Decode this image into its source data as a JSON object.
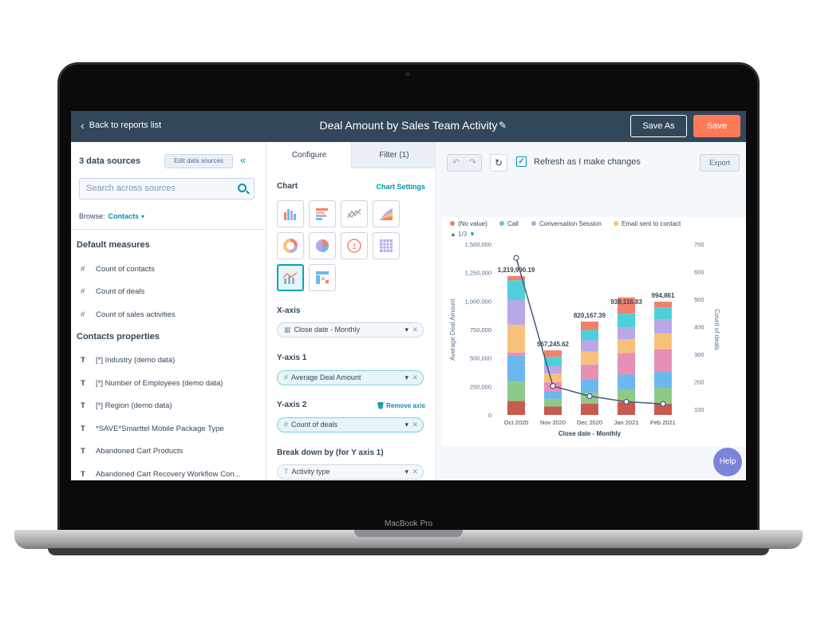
{
  "device": {
    "label": "MacBook Pro"
  },
  "header": {
    "back_label": "Back to reports list",
    "title": "Deal Amount by Sales Team Activity",
    "save_as_label": "Save As",
    "save_label": "Save"
  },
  "left_panel": {
    "data_sources_title": "3 data sources",
    "edit_sources_label": "Edit data sources",
    "search_placeholder": "Search across sources",
    "browse_label": "Browse:",
    "browse_value": "Contacts",
    "default_measures_title": "Default measures",
    "measures": [
      {
        "icon": "#",
        "label": "Count of contacts"
      },
      {
        "icon": "#",
        "label": "Count of deals"
      },
      {
        "icon": "#",
        "label": "Count of sales activities"
      }
    ],
    "properties_title": "Contacts properties",
    "properties": [
      {
        "icon": "T",
        "label": "[*] Industry (demo data)"
      },
      {
        "icon": "T",
        "label": "[*] Number of Employees (demo data)"
      },
      {
        "icon": "T",
        "label": "[*] Region (demo data)"
      },
      {
        "icon": "T",
        "label": "*SAVE*Smarttel Mobile Package Type"
      },
      {
        "icon": "T",
        "label": "Abandoned Cart Products"
      },
      {
        "icon": "T",
        "label": "Abandoned Cart Recovery Workflow Con..."
      }
    ]
  },
  "middle_panel": {
    "tabs": [
      "Configure",
      "Filter (1)"
    ],
    "chart_label": "Chart",
    "chart_settings_label": "Chart Settings",
    "chart_types": [
      "vertical-bar-chart-icon",
      "horizontal-bar-chart-icon",
      "line-chart-icon",
      "area-chart-icon",
      "donut-chart-icon",
      "pie-chart-icon",
      "single-value-icon",
      "table-chart-icon",
      "combination-chart-icon",
      "pivot-table-icon"
    ],
    "selected_chart_type": "combination-chart-icon",
    "x_axis_label": "X-axis",
    "x_axis_value": "Close date - Monthly",
    "y_axis1_label": "Y-axis 1",
    "y_axis1_value": "Average Deal Amount",
    "y_axis2_label": "Y-axis 2",
    "remove_axis_label": "Remove axis",
    "y_axis2_value": "Count of deals",
    "breakdown_label": "Break down by (for Y axis 1)",
    "breakdown_value": "Activity type"
  },
  "right_panel": {
    "refresh_label": "Refresh as I make changes",
    "refresh_checked": true,
    "export_label": "Export",
    "help_label": "Help"
  },
  "chart_data": {
    "type": "bar",
    "legend": [
      {
        "name": "(No value)",
        "color": "#f2816b"
      },
      {
        "name": "Call",
        "color": "#4fd0d9"
      },
      {
        "name": "Conversation Session",
        "color": "#b9a7e8"
      },
      {
        "name": "Email sent to contact",
        "color": "#f7c17c"
      }
    ],
    "legend_page": "1/3",
    "categories": [
      "Oct 2020",
      "Nov 2020",
      "Dec 2020",
      "Jan 2021",
      "Feb 2021"
    ],
    "totals": [
      1219990.19,
      567245.62,
      820167.39,
      938116.83,
      994861
    ],
    "total_labels": [
      "1,219,990.19",
      "567,245.62",
      "820,167.39",
      "938,116.83",
      "994,861"
    ],
    "stack_colors": [
      "#c85a4f",
      "#8fc98a",
      "#6bb7ee",
      "#e88fb6",
      "#f7c17c",
      "#b9a7e8",
      "#4fd0d9",
      "#f2816b"
    ],
    "stack_shares": [
      [
        0.1,
        0.14,
        0.19,
        0.02,
        0.2,
        0.18,
        0.14,
        0.03
      ],
      [
        0.13,
        0.12,
        0.12,
        0.14,
        0.13,
        0.12,
        0.14,
        0.1
      ],
      [
        0.12,
        0.12,
        0.14,
        0.16,
        0.14,
        0.12,
        0.11,
        0.09
      ],
      [
        0.12,
        0.12,
        0.14,
        0.2,
        0.13,
        0.11,
        0.13,
        0.15
      ],
      [
        0.1,
        0.14,
        0.14,
        0.2,
        0.14,
        0.12,
        0.11,
        0.05
      ]
    ],
    "line_series": {
      "name": "Count of deals",
      "values": [
        650,
        185,
        148,
        128,
        120
      ]
    },
    "y_left": {
      "label": "Average Deal Amount",
      "min": 0,
      "max": 1500000,
      "ticks": [
        "0",
        "250,000",
        "500,000",
        "750,000",
        "1,000,000",
        "1,250,000",
        "1,500,000"
      ]
    },
    "y_right": {
      "label": "Count of deals",
      "min": 80,
      "max": 700,
      "ticks": [
        "100",
        "200",
        "300",
        "400",
        "500",
        "600",
        "700"
      ]
    },
    "xlabel": "Close date - Monthly"
  }
}
